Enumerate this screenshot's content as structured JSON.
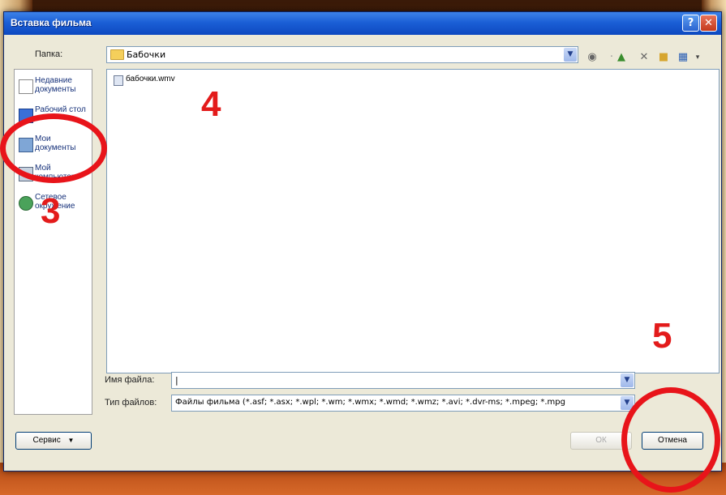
{
  "window": {
    "title": "Вставка фильма",
    "help_icon": "?",
    "close_icon": "✕"
  },
  "toolbar": {
    "folder_label": "Папка:",
    "folder_value": "Бабочки",
    "icons": [
      "back-icon",
      "up-folder-icon",
      "delete-icon",
      "new-folder-icon",
      "view-menu-icon"
    ]
  },
  "places": [
    {
      "label": "Недавние документы",
      "icon": "recent-docs-icon"
    },
    {
      "label": "Рабочий стол",
      "icon": "desktop-icon"
    },
    {
      "label": "Мои документы",
      "icon": "my-documents-icon"
    },
    {
      "label": "Мой компьютер",
      "icon": "my-computer-icon"
    },
    {
      "label": "Сетевое окружение",
      "icon": "network-icon"
    }
  ],
  "files": [
    {
      "name": "бабочки.wmv",
      "icon": "video-file-icon"
    }
  ],
  "filename": {
    "label": "Имя файла:",
    "value": "|"
  },
  "filetype": {
    "label": "Тип файлов:",
    "value": "Файлы фильма (*.asf; *.asx; *.wpl; *.wm; *.wmx; *.wmd; *.wmz; *.avi; *.dvr-ms; *.mpeg; *.mpg"
  },
  "buttons": {
    "service": "Сервис",
    "ok": "ОК",
    "cancel": "Отмена"
  },
  "annotations": [
    "3",
    "4",
    "5"
  ],
  "colors": {
    "titlebar": "#1b5fd6",
    "annotation_red": "#e31b1b"
  }
}
